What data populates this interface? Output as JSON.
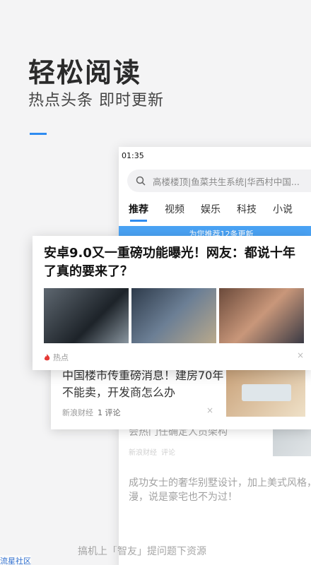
{
  "hero": {
    "title": "轻松阅读",
    "subtitle": "热点头条  即时更新"
  },
  "phone": {
    "status_time": "01:35",
    "search_placeholder": "高楼楼顶|鱼菜共生系统|华西村中国...",
    "tabs": [
      "推荐",
      "视频",
      "娱乐",
      "科技",
      "小说"
    ],
    "active_tab_index": 0,
    "refresh_banner": "为您推荐12条更新"
  },
  "featured_card": {
    "headline": "安卓9.0又一重磅功能曝光！网友：都说十年了真的要来了？",
    "tag": "热点",
    "close_glyph": "×"
  },
  "second_card": {
    "headline": "中国楼市传重磅消息！建房70年不能卖，开发商怎么办",
    "source": "新浪财经",
    "comments": "1 评论",
    "close_glyph": "×"
  },
  "background_feed": [
    {
      "headline": "会热门任确定人员架构",
      "source": "新浪财经",
      "comments": "评论"
    },
    {
      "headline": "成功女士的奢华别墅设计，加上美式风格，漫，说是豪宅也不为过！"
    }
  ],
  "bottom_text": "搞机上「智友」提问题下资源",
  "watermark": "流星社区",
  "colors": {
    "accent": "#2f8cf0",
    "banner": "#4aa3f5",
    "background": "#f4f4f5"
  }
}
